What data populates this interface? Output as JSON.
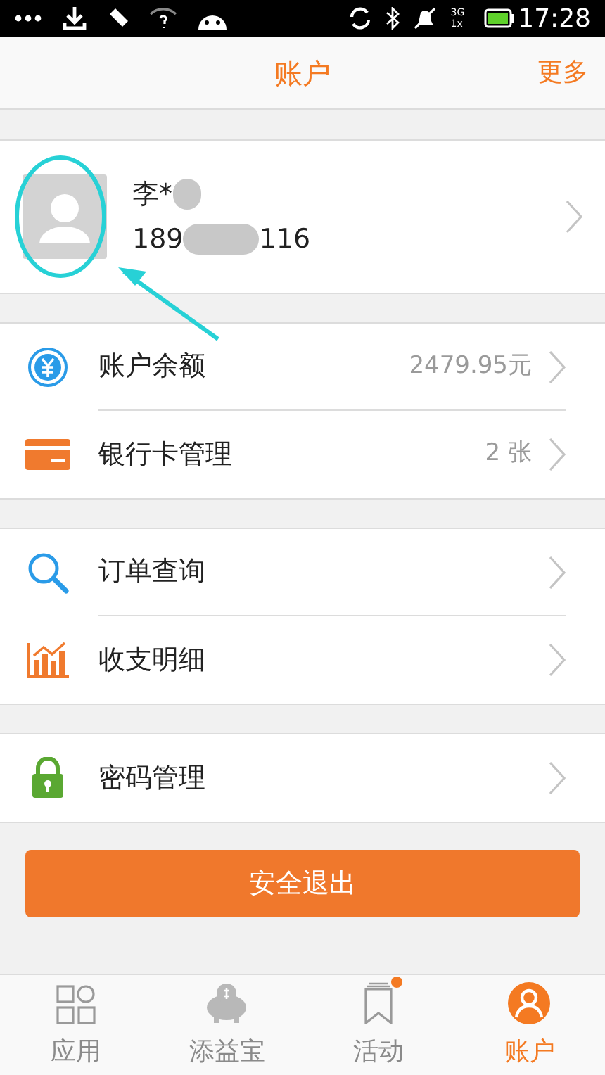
{
  "status_bar": {
    "network": "3G",
    "network_secondary": "1x",
    "time": "17:28"
  },
  "header": {
    "title": "账户",
    "action": "更多"
  },
  "profile": {
    "name": "李*",
    "phone_start": "189",
    "phone_end": "116"
  },
  "groups": [
    {
      "items": [
        {
          "kind": "yuan",
          "label": "账户余额",
          "value": "2479.95元"
        },
        {
          "kind": "card",
          "label": "银行卡管理",
          "value": "2 张"
        }
      ]
    },
    {
      "items": [
        {
          "kind": "search",
          "label": "订单查询"
        },
        {
          "kind": "chart",
          "label": "收支明细"
        }
      ]
    },
    {
      "items": [
        {
          "kind": "lock",
          "label": "密码管理"
        }
      ]
    }
  ],
  "logout_button": "安全退出",
  "tabs": [
    {
      "kind": "apps",
      "label": "应用",
      "selected": false,
      "badge": false
    },
    {
      "kind": "piggy",
      "label": "添益宝",
      "selected": false,
      "badge": false
    },
    {
      "kind": "bookmark",
      "label": "活动",
      "selected": false,
      "badge": true
    },
    {
      "kind": "person",
      "label": "账户",
      "selected": true,
      "badge": false
    }
  ]
}
